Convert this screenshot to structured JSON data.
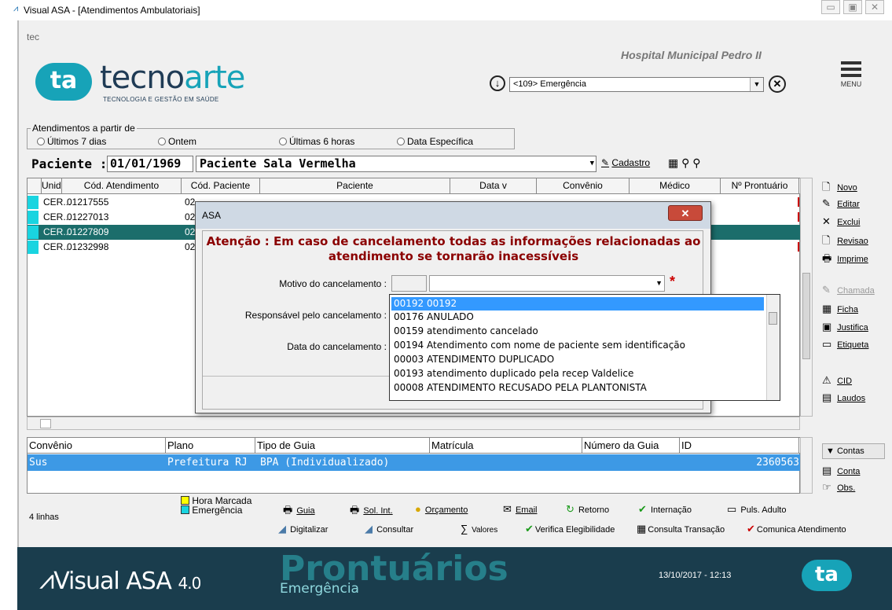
{
  "window": {
    "title": "Visual ASA - [Atendimentos Ambulatoriais]",
    "buttons": [
      "▭",
      "▣",
      "✕"
    ]
  },
  "header": {
    "user": "tec",
    "brand": {
      "logo": "ta",
      "name_a": "tecno",
      "name_b": "arte",
      "tagline": "TECNOLOGIA E GESTÃO EM SAÚDE"
    },
    "hospital": "Hospital Municipal Pedro II",
    "unit": "<109> Emergência",
    "menu_label": "MENU"
  },
  "range": {
    "legend": "Atendimentos a partir de",
    "options": [
      "Últimos 7 dias",
      "Ontem",
      "Últimas 6 horas",
      "Data Específica"
    ]
  },
  "patient": {
    "label": "Paciente :",
    "date": "01/01/1969",
    "name": "Paciente Sala Vermelha",
    "cadastro": "Cadastro"
  },
  "grid": {
    "columns": [
      "Unidade",
      "Cód. Atendimento",
      "Cód. Paciente",
      "Paciente",
      "Data v",
      "Convênio",
      "Médico",
      "Nº Prontuário"
    ],
    "rows": [
      {
        "unit": "CER...",
        "code": "01217555",
        "pcode": "02"
      },
      {
        "unit": "CER...",
        "code": "01227013",
        "pcode": "02"
      },
      {
        "unit": "CER...",
        "code": "01227809",
        "pcode": "02"
      },
      {
        "unit": "CER...",
        "code": "01232998",
        "pcode": "02"
      }
    ]
  },
  "side_actions": [
    {
      "icon": "🗋",
      "label": "Novo",
      "name": "novo-button"
    },
    {
      "icon": "✎",
      "label": "Editar",
      "name": "editar-button"
    },
    {
      "icon": "✕",
      "label": "Exclui",
      "name": "exclui-button"
    },
    {
      "icon": "🗋",
      "label": "Revisao",
      "name": "revisao-button"
    },
    {
      "icon": "🖶",
      "label": "Imprime",
      "name": "imprime-button"
    },
    {
      "icon": "✎",
      "label": "Chamada",
      "name": "chamada-button"
    },
    {
      "icon": "▦",
      "label": "Ficha",
      "name": "ficha-button"
    },
    {
      "icon": "▣",
      "label": "Justifica",
      "name": "justifica-button"
    },
    {
      "icon": "▭",
      "label": "Etiqueta",
      "name": "etiqueta-button"
    },
    {
      "icon": "⚠",
      "label": "CID",
      "name": "cid-button"
    },
    {
      "icon": "▤",
      "label": "Laudos",
      "name": "laudos-button"
    }
  ],
  "grid2": {
    "columns": [
      "Convênio",
      "Plano",
      "Tipo de Guia",
      "Matrícula",
      "Número da Guia",
      "ID"
    ],
    "row": {
      "convenio": "Sus",
      "plano": "Prefeitura RJ",
      "tipo": "BPA (Individualizado)",
      "matricula": "",
      "numero": "",
      "id": "2360563"
    }
  },
  "side2": [
    {
      "icon": "▼",
      "label": "Contas"
    },
    {
      "icon": "▤",
      "label": "Conta"
    },
    {
      "icon": "☞",
      "label": "Obs."
    }
  ],
  "legend": {
    "hora_marcada": "Hora Marcada",
    "emergencia": "Emergência",
    "hora_color": "#ffff00",
    "emerg_color": "#19d4e0"
  },
  "toolbar": {
    "row1": [
      "Guia",
      "Sol. Int.",
      "Orçamento",
      "Email",
      "Retorno",
      "Internação",
      "Puls. Adulto"
    ],
    "row2": [
      "Digitalizar",
      "Consultar",
      "Valores",
      "Verifica Elegibilidade",
      "Consulta Transação",
      "Comunica Atendimento"
    ]
  },
  "linhas": "4 linhas",
  "footer": {
    "product": "Visual ASA",
    "version": "4.0",
    "module": "Prontuários",
    "sub": "Emergência",
    "datetime": "13/10/2017 - 12:13",
    "logo": "ta"
  },
  "dialog": {
    "title": "ASA",
    "warning_1": "Atenção : Em caso de cancelamento todas as informações relacionadas ao",
    "warning_2": "atendimento se tornarão inacessíveis",
    "motivo_label": "Motivo do cancelamento :",
    "responsavel_label": "Responsável pelo cancelamento :",
    "data_label": "Data do cancelamento :",
    "options": [
      {
        "code": "00192",
        "text": "00192"
      },
      {
        "code": "00176",
        "text": "ANULADO"
      },
      {
        "code": "00159",
        "text": "atendimento cancelado"
      },
      {
        "code": "00194",
        "text": "Atendimento com nome de paciente sem identificação"
      },
      {
        "code": "00003",
        "text": "ATENDIMENTO DUPLICADO"
      },
      {
        "code": "00193",
        "text": "atendimento duplicado pela recep Valdelice"
      },
      {
        "code": "00008",
        "text": "ATENDIMENTO RECUSADO PELA PLANTONISTA"
      }
    ]
  },
  "colors": {
    "accent": "#17a3b8",
    "selected_row": "#1b6d6b",
    "footer": "#1a3d4d",
    "list_select": "#3399ff"
  }
}
